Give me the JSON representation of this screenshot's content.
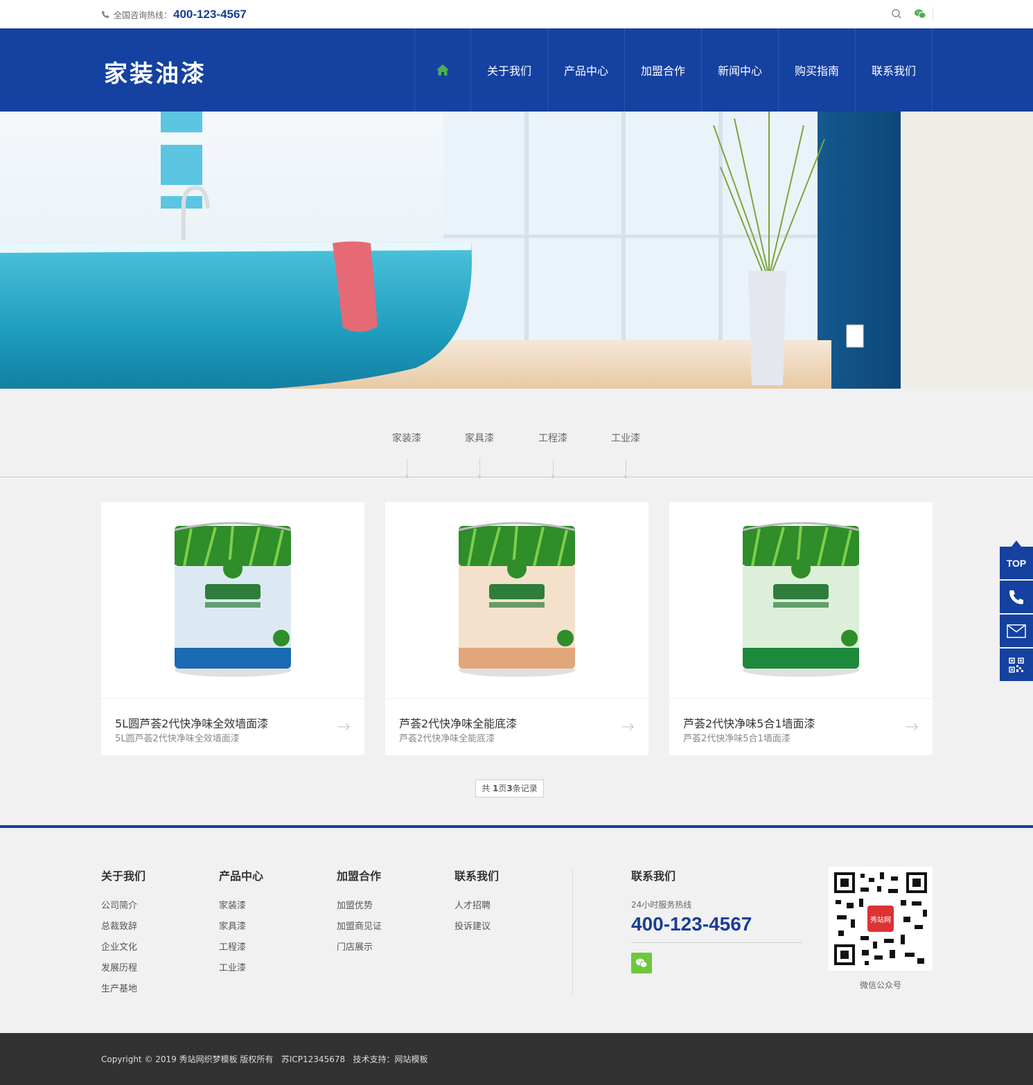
{
  "topbar": {
    "hotline_label": "全国咨询热线：",
    "hotline_number": "400-123-4567"
  },
  "header": {
    "logo": "家装油漆",
    "nav": [
      "关于我们",
      "产品中心",
      "加盟合作",
      "新闻中心",
      "购买指南",
      "联系我们"
    ]
  },
  "categories": [
    "家装漆",
    "家具漆",
    "工程漆",
    "工业漆"
  ],
  "products": [
    {
      "name": "5L圆芦荟2代快净味全效墙面漆",
      "sub": "5L圆芦荟2代快净味全效墙面漆",
      "can_color": "#1a6bb3",
      "label_color": "#dce9f3"
    },
    {
      "name": "芦荟2代快净味全能底漆",
      "sub": "芦荟2代快净味全能底漆",
      "can_color": "#e1a77b",
      "label_color": "#f3e1cc"
    },
    {
      "name": "芦荟2代快净味5合1墙面漆",
      "sub": "芦荟2代快净味5合1墙面漆",
      "can_color": "#1c8a3a",
      "label_color": "#dcefd9"
    }
  ],
  "pager": {
    "prefix": "共 ",
    "pages": "1",
    "mid": "页",
    "records": "3",
    "suffix": "条记录"
  },
  "footer": {
    "cols": [
      {
        "title": "关于我们",
        "links": [
          "公司简介",
          "总裁致辞",
          "企业文化",
          "发展历程",
          "生产基地"
        ]
      },
      {
        "title": "产品中心",
        "links": [
          "家装漆",
          "家具漆",
          "工程漆",
          "工业漆"
        ]
      },
      {
        "title": "加盟合作",
        "links": [
          "加盟优势",
          "加盟商见证",
          "门店展示"
        ]
      },
      {
        "title": "联系我们",
        "links": [
          "人才招聘",
          "投诉建议"
        ]
      }
    ],
    "contact": {
      "title": "联系我们",
      "label": "24小时服务热线",
      "tel": "400-123-4567"
    },
    "qr_label": "微信公众号",
    "qr_logo": "秀站网",
    "copyright": "Copyright © 2019 秀站网织梦模板 版权所有   苏ICP12345678   技术支持：网站模板"
  },
  "side": {
    "top_label": "TOP"
  },
  "colors": {
    "brand": "#1541a0",
    "accent_green": "#6dc93a",
    "home_icon": "#4caf50"
  }
}
